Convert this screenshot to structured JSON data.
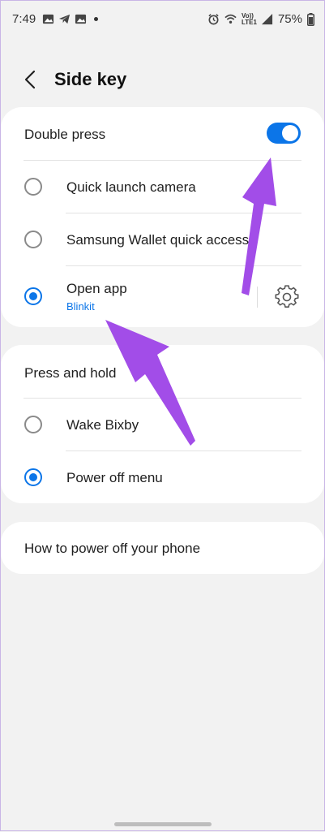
{
  "status_bar": {
    "time": "7:49",
    "battery": "75%",
    "volte_label": "Vo)) LTE1"
  },
  "header": {
    "title": "Side key"
  },
  "double_press": {
    "label": "Double press",
    "enabled": true,
    "options": [
      {
        "label": "Quick launch camera",
        "selected": false
      },
      {
        "label": "Samsung Wallet quick access",
        "selected": false
      },
      {
        "label": "Open app",
        "sub_label": "Blinkit",
        "selected": true
      }
    ]
  },
  "press_and_hold": {
    "label": "Press and hold",
    "options": [
      {
        "label": "Wake Bixby",
        "selected": false
      },
      {
        "label": "Power off menu",
        "selected": true
      }
    ]
  },
  "help_link": {
    "label": "How to power off your phone"
  },
  "colors": {
    "accent": "#0b75e8",
    "annotation_arrow": "#a24de8",
    "background": "#f2f2f2"
  }
}
